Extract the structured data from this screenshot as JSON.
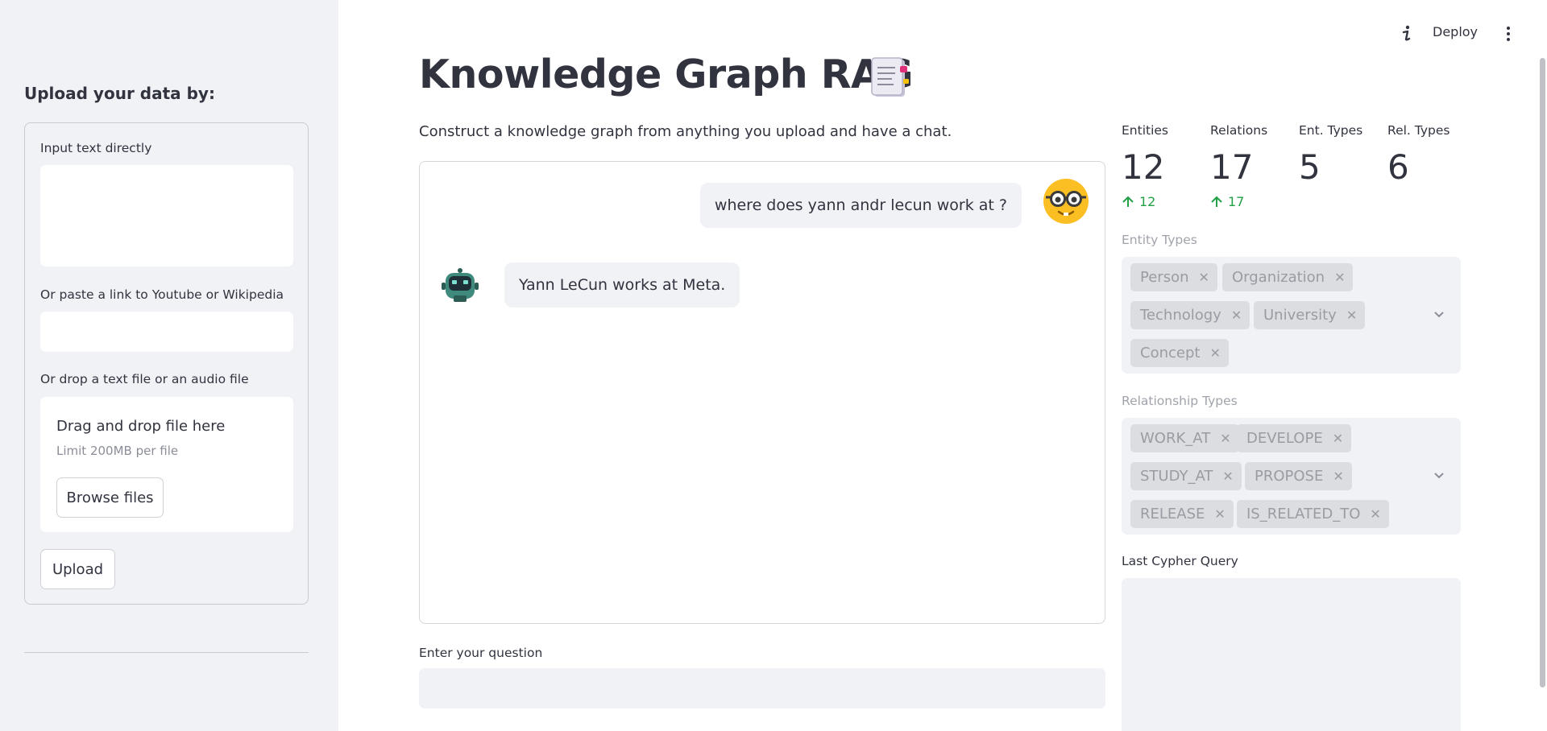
{
  "sidebar": {
    "heading": "Upload your data by:",
    "text_label": "Input text directly",
    "text_value": "",
    "link_label": "Or paste a link to Youtube or Wikipedia",
    "link_value": "",
    "file_label": "Or drop a text file or an audio file",
    "drop_title": "Drag and drop file here",
    "drop_limit": "Limit 200MB per file",
    "browse_label": "Browse files",
    "upload_label": "Upload"
  },
  "toolbar": {
    "info_icon": "info-icon",
    "deploy_label": "Deploy",
    "menu_icon": "more-vertical-icon"
  },
  "main": {
    "title": "Knowledge Graph RAG",
    "title_icon": "notebook-icon",
    "subtitle": "Construct a knowledge graph from anything you upload and have a chat.",
    "question_label": "Enter your question",
    "question_value": ""
  },
  "chat": {
    "messages": [
      {
        "role": "user",
        "avatar": "nerd-face-icon",
        "text": "where does yann andr lecun work at ?"
      },
      {
        "role": "assistant",
        "avatar": "robot-icon",
        "text": "Yann LeCun works at Meta."
      }
    ]
  },
  "metrics": [
    {
      "label": "Entities",
      "value": "12",
      "delta": "12"
    },
    {
      "label": "Relations",
      "value": "17",
      "delta": "17"
    },
    {
      "label": "Ent. Types",
      "value": "5",
      "delta": ""
    },
    {
      "label": "Rel. Types",
      "value": "6",
      "delta": ""
    }
  ],
  "entity_types": {
    "label": "Entity Types",
    "chips": [
      "Person",
      "Organization",
      "Technology",
      "University",
      "Concept"
    ]
  },
  "relationship_types": {
    "label": "Relationship Types",
    "chips": [
      "WORK_AT",
      "DEVELOPE",
      "STUDY_AT",
      "PROPOSE",
      "RELEASE",
      "IS_RELATED_TO"
    ]
  },
  "cypher": {
    "label": "Last Cypher Query",
    "value": ""
  },
  "colors": {
    "sidebar_bg": "#f0f2f6",
    "text": "#31333f",
    "delta_green": "#21a045",
    "chip_bg": "#dcdde1",
    "muted": "#a0a3ab"
  }
}
